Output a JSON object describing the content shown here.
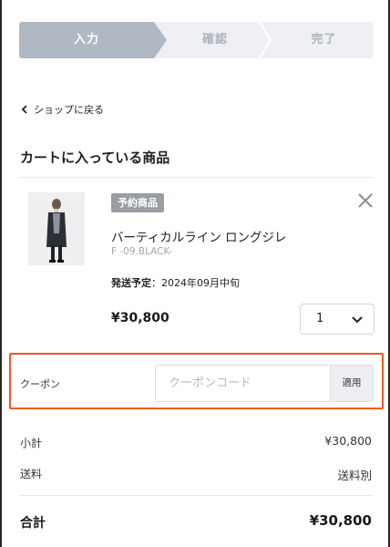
{
  "stepper": {
    "steps": [
      {
        "label": "入力"
      },
      {
        "label": "確認"
      },
      {
        "label": "完了"
      }
    ]
  },
  "nav": {
    "back_label": "ショップに戻る"
  },
  "cart": {
    "title": "カートに入っている商品",
    "item": {
      "badge": "予約商品",
      "name": "バーティカルライン ロングジレ",
      "variant": "F -09.BLACK-",
      "ship_label": "発送予定",
      "ship_value": "：2024年09月中旬",
      "price": "¥30,800",
      "quantity": "1"
    }
  },
  "coupon": {
    "label": "クーポン",
    "placeholder": "クーポンコード",
    "apply_label": "適用"
  },
  "summary": {
    "subtotal_label": "小計",
    "subtotal_value": "¥30,800",
    "shipping_label": "送料",
    "shipping_value": "送料別",
    "total_label": "合計",
    "total_value": "¥30,800"
  },
  "colors": {
    "highlight_border": "#ee5a24",
    "step_active": "#b0b8c3"
  }
}
